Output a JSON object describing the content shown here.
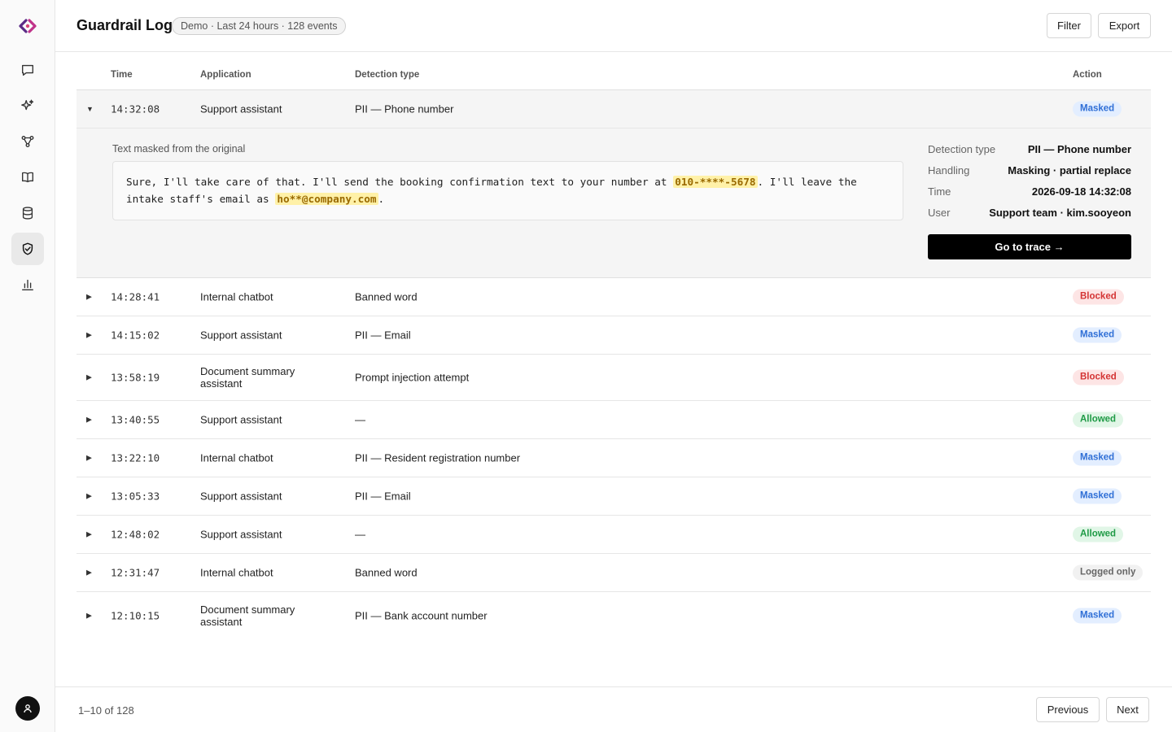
{
  "sidebar": {
    "logo": "logo-mark",
    "items": [
      {
        "name": "chat-icon",
        "active": false
      },
      {
        "name": "sparkle-icon",
        "active": false
      },
      {
        "name": "workflow-icon",
        "active": false
      },
      {
        "name": "book-icon",
        "active": false
      },
      {
        "name": "database-icon",
        "active": false
      },
      {
        "name": "shield-icon",
        "active": true
      },
      {
        "name": "bar-chart-icon",
        "active": false
      }
    ],
    "user_icon": "user-icon"
  },
  "header": {
    "title": "Guardrail Log",
    "badge": "Demo · Last 24 hours · 128 events",
    "filter_label": "Filter",
    "export_label": "Export"
  },
  "table": {
    "columns": {
      "time": "Time",
      "application": "Application",
      "detection": "Detection type",
      "action": "Action"
    },
    "rows": [
      {
        "time": "14:32:08",
        "application": "Support assistant",
        "detection": "PII — Phone number",
        "action": "Masked",
        "status": "masked",
        "expanded": true
      },
      {
        "time": "14:28:41",
        "application": "Internal chatbot",
        "detection": "Banned word",
        "action": "Blocked",
        "status": "blocked"
      },
      {
        "time": "14:15:02",
        "application": "Support assistant",
        "detection": "PII — Email",
        "action": "Masked",
        "status": "masked"
      },
      {
        "time": "13:58:19",
        "application": "Document summary assistant",
        "detection": "Prompt injection attempt",
        "action": "Blocked",
        "status": "blocked"
      },
      {
        "time": "13:40:55",
        "application": "Support assistant",
        "detection": "—",
        "action": "Allowed",
        "status": "allowed"
      },
      {
        "time": "13:22:10",
        "application": "Internal chatbot",
        "detection": "PII — Resident registration number",
        "action": "Masked",
        "status": "masked"
      },
      {
        "time": "13:05:33",
        "application": "Support assistant",
        "detection": "PII — Email",
        "action": "Masked",
        "status": "masked"
      },
      {
        "time": "12:48:02",
        "application": "Support assistant",
        "detection": "—",
        "action": "Allowed",
        "status": "allowed"
      },
      {
        "time": "12:31:47",
        "application": "Internal chatbot",
        "detection": "Banned word",
        "action": "Logged only",
        "status": "logged"
      },
      {
        "time": "12:10:15",
        "application": "Document summary assistant",
        "detection": "PII — Bank account number",
        "action": "Masked",
        "status": "masked"
      }
    ],
    "status_colors": {
      "masked": "#2f6fd6",
      "blocked": "#d43333",
      "allowed": "#1e9a45",
      "logged": "#666666"
    }
  },
  "detail": {
    "masked_label": "Text masked from the original",
    "text_parts": [
      "Sure, I'll take care of that. I'll send the booking confirmation text to your number at ",
      "010-****-5678",
      ". I'll leave the intake staff's email as ",
      "ho**@company.com",
      "."
    ],
    "meta": [
      {
        "key": "Detection type",
        "value": "PII — Phone number"
      },
      {
        "key": "Handling",
        "value": "Masking · partial replace"
      },
      {
        "key": "Time",
        "value": "2026-09-18 14:32:08"
      },
      {
        "key": "User",
        "value": "Support team · kim.sooyeon"
      }
    ],
    "trace_button": "Go to trace →"
  },
  "footer": {
    "range_text": "1–10 of 128",
    "previous_label": "Previous",
    "next_label": "Next"
  }
}
